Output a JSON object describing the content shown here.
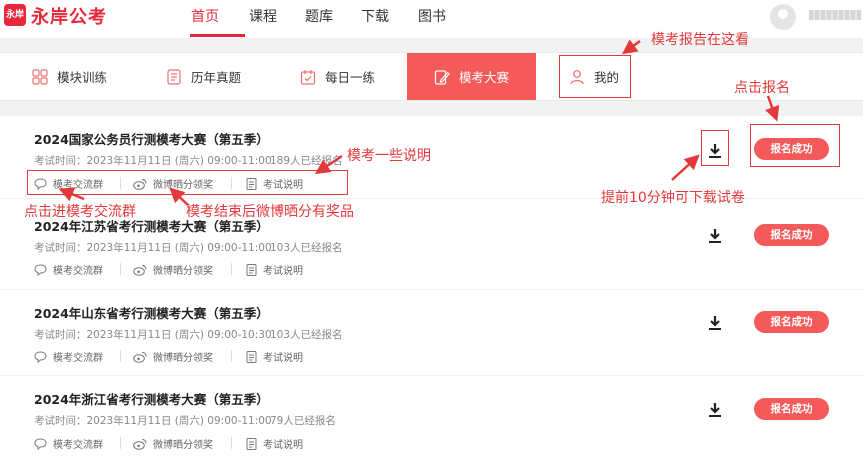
{
  "header": {
    "logo_badge": "永岸",
    "logo_text": "永岸公考",
    "nav": [
      {
        "label": "首页",
        "active": true
      },
      {
        "label": "课程",
        "active": false
      },
      {
        "label": "题库",
        "active": false
      },
      {
        "label": "下载",
        "active": false
      },
      {
        "label": "图书",
        "active": false
      }
    ]
  },
  "tabs": [
    {
      "label": "模块训练",
      "icon": "grid-icon"
    },
    {
      "label": "历年真题",
      "icon": "document-icon"
    },
    {
      "label": "每日一练",
      "icon": "calendar-check-icon"
    },
    {
      "label": "模考大赛",
      "icon": "pencil-doc-icon",
      "active": true
    },
    {
      "label": "我的",
      "icon": "user-icon"
    }
  ],
  "card_links": {
    "group": "模考交流群",
    "weibo": "微博晒分领奖",
    "notes": "考试说明"
  },
  "exams": [
    {
      "title": "2024国家公务员行测模考大赛（第五季）",
      "time": "考试时间：2023年11月11日 (周六) 09:00-11:00",
      "count": "189人已经报名",
      "status": "报名成功"
    },
    {
      "title": "2024年江苏省考行测模考大赛（第五季）",
      "time": "考试时间：2023年11月11日 (周六) 09:00-11:00",
      "count": "103人已经报名",
      "status": "报名成功"
    },
    {
      "title": "2024年山东省考行测模考大赛（第五季）",
      "time": "考试时间：2023年11月11日 (周六) 09:00-10:30",
      "count": "103人已经报名",
      "status": "报名成功"
    },
    {
      "title": "2024年浙江省考行测模考大赛（第五季）",
      "time": "考试时间：2023年11月11日 (周六) 09:00-11:00",
      "count": "79人已经报名",
      "status": "报名成功"
    }
  ],
  "annotations": {
    "report": "模考报告在这看",
    "signup": "点击报名",
    "notes": "模考一些说明",
    "download": "提前10分钟可下载试卷",
    "group": "点击进模考交流群",
    "weibo": "模考结束后微博晒分有奖品"
  },
  "colors": {
    "accent": "#f55a5a",
    "brand": "#e6283b",
    "annotation": "#e4393c"
  }
}
